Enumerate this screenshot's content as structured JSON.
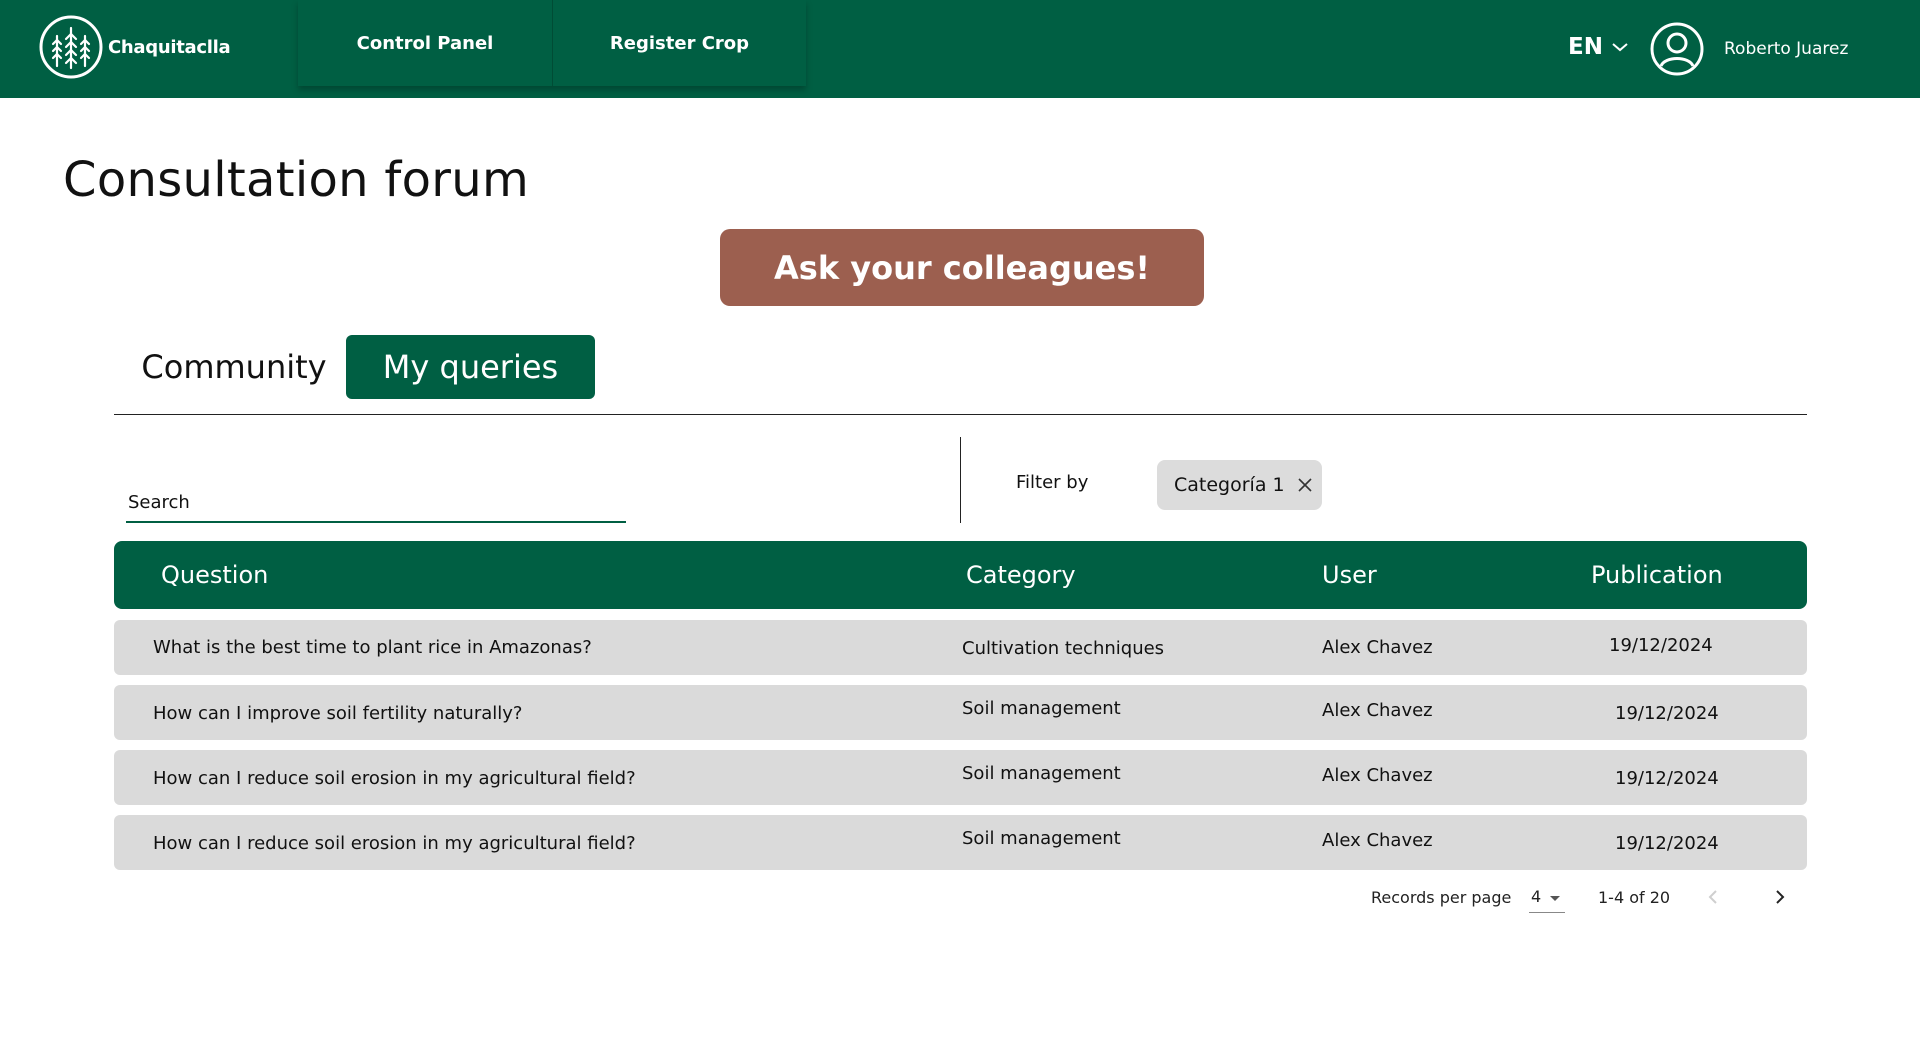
{
  "header": {
    "brand": "Chaquitaclla",
    "nav": [
      "Control Panel",
      "Register Crop"
    ],
    "language": "EN",
    "user_name": "Roberto Juarez"
  },
  "page": {
    "title": "Consultation forum",
    "cta_label": "Ask your colleagues!",
    "tabs": [
      "Community",
      "My queries"
    ],
    "active_tab": "My queries"
  },
  "filters": {
    "search_placeholder": "Search",
    "filter_label": "Filter by",
    "chip": "Categoría 1"
  },
  "table": {
    "columns": [
      "Question",
      "Category",
      "User",
      "Publication"
    ],
    "rows": [
      {
        "question": "What is the best time to plant rice in Amazonas?",
        "category": "Cultivation techniques",
        "user": "Alex Chavez",
        "publication": "19/12/2024"
      },
      {
        "question": "How can I improve soil fertility naturally?",
        "category": "Soil management",
        "user": "Alex Chavez",
        "publication": "19/12/2024"
      },
      {
        "question": "How can I reduce soil erosion in my agricultural field?",
        "category": "Soil management",
        "user": "Alex Chavez",
        "publication": "19/12/2024"
      },
      {
        "question": "How can I reduce soil erosion in my agricultural field?",
        "category": "Soil management",
        "user": "Alex Chavez",
        "publication": "19/12/2024"
      }
    ]
  },
  "pagination": {
    "label": "Records per page",
    "per_page": "4",
    "range": "1-4 of 20"
  },
  "colors": {
    "primary": "#005f43",
    "cta": "#9c5f4f",
    "row_bg": "#dadada",
    "chip_bg": "#dcdcdc"
  },
  "icons": {
    "logo": "wheat-logo-icon",
    "language_toggle": "chevron-down-icon",
    "user": "user-circle-icon",
    "chip_remove": "close-icon",
    "prev": "chevron-left-icon",
    "next": "chevron-right-icon"
  }
}
